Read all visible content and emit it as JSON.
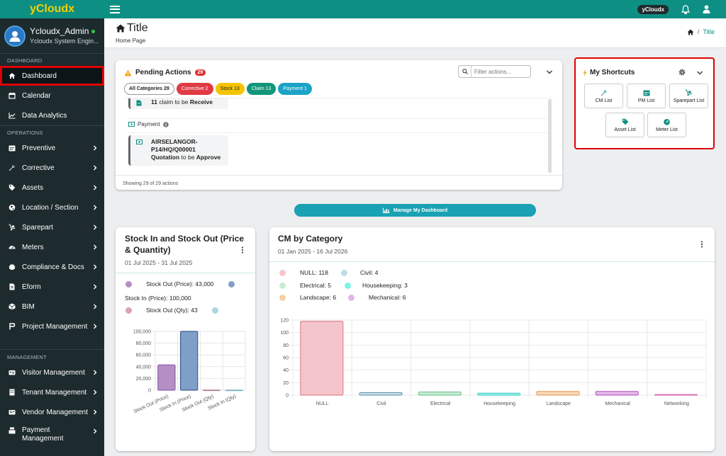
{
  "brand": "yCloudx",
  "topbar": {
    "badge": "yCloudx"
  },
  "user": {
    "name": "Ycloudx_Admin",
    "role": "Ycloudx System Engin..."
  },
  "sidebar": {
    "section_dashboard": "DASHBOARD",
    "section_operations": "OPERATIONS",
    "section_management": "MANAGEMENT",
    "dashboard": "Dashboard",
    "calendar": "Calendar",
    "analytics": "Data Analytics",
    "operations": [
      "Preventive",
      "Corrective",
      "Assets",
      "Location / Section",
      "Sparepart",
      "Meters",
      "Compliance & Docs",
      "Eform",
      "BIM",
      "Project Management"
    ],
    "management": [
      "Visitor Management",
      "Tenant Management",
      "Vendor Management"
    ],
    "payment": "Payment",
    "payment2": "Management"
  },
  "page": {
    "title": "Title",
    "subtitle": "Home Page",
    "breadcrumb_current": "Title",
    "breadcrumb_sep": "/"
  },
  "pending": {
    "title": "Pending Actions",
    "count": "29",
    "filter_placeholder": "Filter actions...",
    "chips": [
      "All Categories 29",
      "Corrective 2",
      "Stock 13",
      "Claim 13",
      "Payment 1"
    ],
    "claim_num": "11",
    "claim_mid": "claim to be",
    "claim_action": "Receive",
    "payment_header": "Payment",
    "payment_code": "AIRSELANGOR-",
    "payment_code2": "P14/HQ/Q00001",
    "payment_type": "Quotation",
    "payment_mid": "to be",
    "payment_action": "Approve",
    "footer": "Showing 29 of 29 actions"
  },
  "shortcuts": {
    "title": "My Shortcuts",
    "items": [
      "CM List",
      "PM List",
      "Sparepart List",
      "Asset List",
      "Meter List"
    ]
  },
  "manage_label": "Manage My Dashboard",
  "stock_card": {
    "title1": "Stock In and Stock Out (Price",
    "title2": "& Quantity)",
    "date": "01 Jul 2025 - 31 Jul 2025"
  },
  "cm_card": {
    "title": "CM by Category",
    "date": "01 Jan 2025 - 16 Jul 2026"
  },
  "colors": {
    "teal": "#0e8f83",
    "sidebar": "#1d2a2e",
    "brand": "#f2d000",
    "highlight": "#e10000"
  },
  "chart_data": [
    {
      "type": "bar",
      "title": "Stock In and Stock Out (Price & Quantity)",
      "categories": [
        "Stock Out (Price)",
        "Stock In (Price)",
        "Stock Out (Qty)",
        "Stock In (Qty)"
      ],
      "legend": [
        {
          "name": "Stock Out (Price): 43,000",
          "color": "#b58fc4"
        },
        {
          "name": "Stock In (Price): 100,000",
          "color": "#7f9fc9"
        },
        {
          "name": "Stock Out (Qty): 43",
          "color": "#d8a3b2"
        },
        {
          "name": "Stock In (Qty)",
          "color": "#a8d6e3"
        }
      ],
      "values": [
        43000,
        100000,
        43,
        0
      ],
      "colors": [
        "#b58fc4",
        "#7f9fc9",
        "#d8a3b2",
        "#a8d6e3"
      ],
      "strokes": [
        "#8a5ea6",
        "#3d5f91",
        "#b0738a",
        "#6fb0c4"
      ],
      "yticks": [
        "100,000",
        "80,000",
        "60,000",
        "40,000",
        "20,000",
        "0"
      ],
      "ylim": [
        0,
        100000
      ]
    },
    {
      "type": "bar",
      "title": "CM by Category",
      "categories": [
        "NULL",
        "Civil",
        "Electrical",
        "Housekeeping",
        "Landscape",
        "Mechanical",
        "Networking"
      ],
      "legend": [
        {
          "name": "NULL: 118",
          "color": "#f4c6cc"
        },
        {
          "name": "Civil: 4",
          "color": "#bfdde6"
        },
        {
          "name": "Electrical: 5",
          "color": "#c8ecd3"
        },
        {
          "name": "Housekeeping: 3",
          "color": "#7ff2ea"
        },
        {
          "name": "Landscape: 6",
          "color": "#f8cfa6"
        },
        {
          "name": "Mechanical: 6",
          "color": "#e5b6ea"
        }
      ],
      "values": [
        118,
        4,
        5,
        3,
        6,
        6,
        1
      ],
      "colors": [
        "#f4c6cc",
        "#cfe3ea",
        "#c8ecd3",
        "#b5f1ee",
        "#f8d7b6",
        "#e5b6ea",
        "#f8c4e4"
      ],
      "strokes": [
        "#e0848f",
        "#6d9bb0",
        "#7cc493",
        "#3fd3c6",
        "#e8a564",
        "#b56ac0",
        "#e07ab5"
      ],
      "yticks": [
        "120",
        "100",
        "80",
        "60",
        "40",
        "20",
        "0"
      ],
      "ylim": [
        0,
        120
      ]
    }
  ]
}
